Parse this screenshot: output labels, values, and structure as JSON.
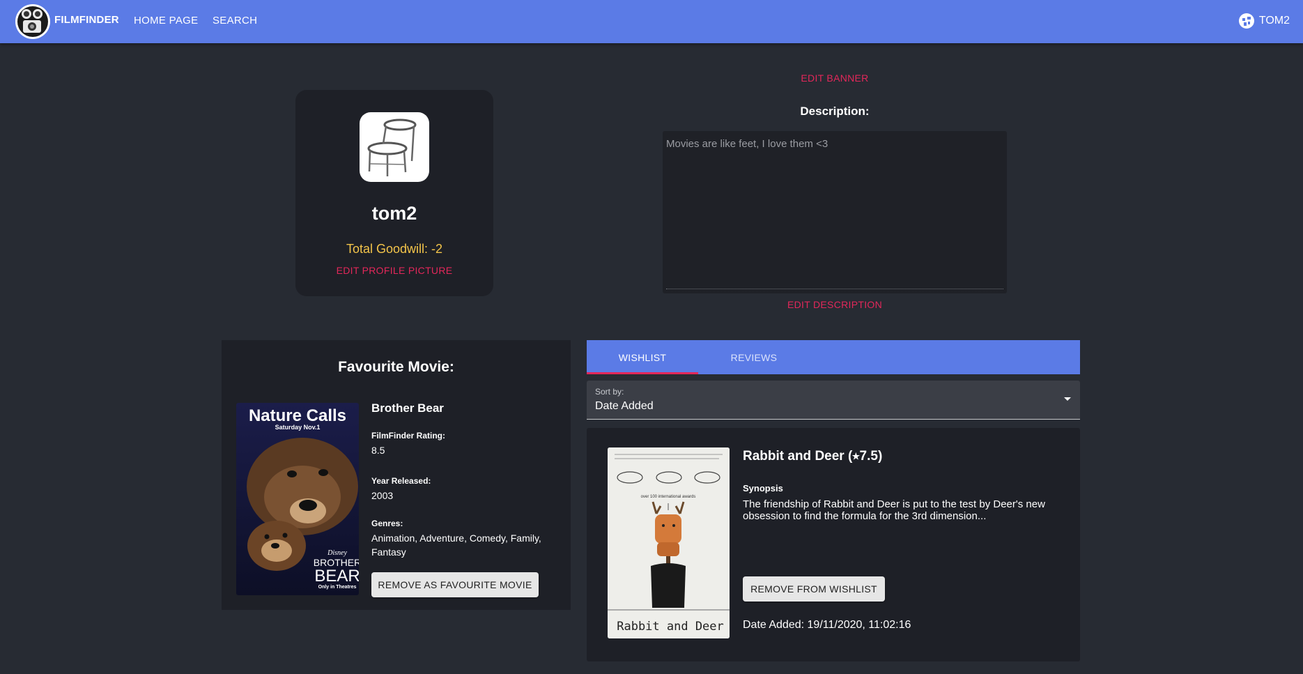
{
  "navbar": {
    "brand": "FILMFINDER",
    "links": [
      "HOME PAGE",
      "SEARCH"
    ],
    "user": "TOM2"
  },
  "profile": {
    "username": "tom2",
    "goodwill": "Total Goodwill: -2",
    "edit_picture": "EDIT PROFILE PICTURE"
  },
  "banner": {
    "edit_label": "EDIT BANNER"
  },
  "description": {
    "label": "Description:",
    "text": "Movies are like feet, I love them <3",
    "edit_label": "EDIT DESCRIPTION"
  },
  "favourite": {
    "title": "Favourite Movie:",
    "poster_text": [
      "Nature Calls",
      "Saturday Nov.1",
      "BROTHER",
      "BEAR",
      "Only in Theatres",
      "Disney"
    ],
    "name": "Brother Bear",
    "rating_label": "FilmFinder Rating:",
    "rating": "8.5",
    "year_label": "Year Released:",
    "year": "2003",
    "genres_label": "Genres:",
    "genres": "Animation, Adventure, Comedy, Family, Fantasy",
    "remove_label": "REMOVE AS FAVOURITE MOVIE"
  },
  "tabs": [
    "WISHLIST",
    "REVIEWS"
  ],
  "sort": {
    "label": "Sort by:",
    "value": "Date Added"
  },
  "wishlist_item": {
    "title": "Rabbit and Deer (⭑7.5)",
    "synopsis_label": "Synopsis",
    "synopsis": "The friendship of Rabbit and Deer is put to the test by Deer's new obsession to find the formula for the 3rd dimension...",
    "poster_title": "Rabbit and Deer",
    "poster_awards": "over 100 international awards",
    "remove_label": "REMOVE FROM WISHLIST",
    "date_added": "Date Added: 19/11/2020, 11:02:16"
  },
  "colors": {
    "background": "#272b33",
    "navbar": "#5b7be6",
    "panel": "#1e2027",
    "accent": "#e3275a",
    "goodwill": "#f3c44a"
  }
}
